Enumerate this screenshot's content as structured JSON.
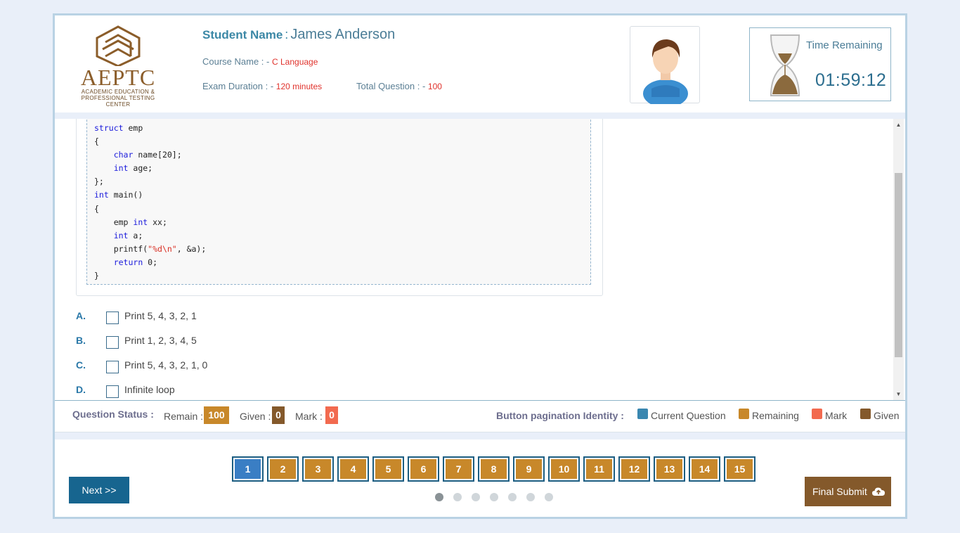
{
  "header": {
    "logo_text": "AEPTC",
    "logo_sub_line1": "ACADEMIC EDUCATION &",
    "logo_sub_line2": "PROFESSIONAL TESTING CENTER",
    "student_label": "Student Name",
    "student_sep": ":",
    "student_name": "James Anderson",
    "course_label": "Course Name : -",
    "course_value": "C Language",
    "duration_label": "Exam Duration : -",
    "duration_value": "120 minutes",
    "total_label": "Total Question : -",
    "total_value": "100",
    "timer_label": "Time Remaining",
    "timer_value": "01:59:12"
  },
  "question": {
    "options": [
      {
        "letter": "A.",
        "text": "Print 5, 4, 3, 2, 1"
      },
      {
        "letter": "B.",
        "text": "Print 1, 2, 3, 4, 5"
      },
      {
        "letter": "C.",
        "text": "Print 5, 4, 3, 2, 1, 0"
      },
      {
        "letter": "D.",
        "text": "Infinite loop"
      }
    ]
  },
  "status": {
    "label": "Question Status :",
    "remain_label": "Remain :",
    "remain_value": "100",
    "given_label": "Given :",
    "given_value": "0",
    "mark_label": "Mark :",
    "mark_value": "0",
    "legend_label": "Button pagination Identity :",
    "legend": [
      {
        "label": "Current Question",
        "color": "#3a87b0"
      },
      {
        "label": "Remaining",
        "color": "#c8882a"
      },
      {
        "label": "Mark",
        "color": "#f26a4f"
      },
      {
        "label": "Given",
        "color": "#84592b"
      }
    ]
  },
  "colors": {
    "current": "#3a7ec4",
    "remaining": "#c8882a",
    "mark": "#f26a4f",
    "given": "#84592b"
  },
  "navigation": {
    "next_label": "Next  >>",
    "submit_label": "Final Submit",
    "pages": [
      "1",
      "2",
      "3",
      "4",
      "5",
      "6",
      "7",
      "8",
      "9",
      "10",
      "11",
      "12",
      "13",
      "14",
      "15"
    ],
    "current_page": "1"
  }
}
